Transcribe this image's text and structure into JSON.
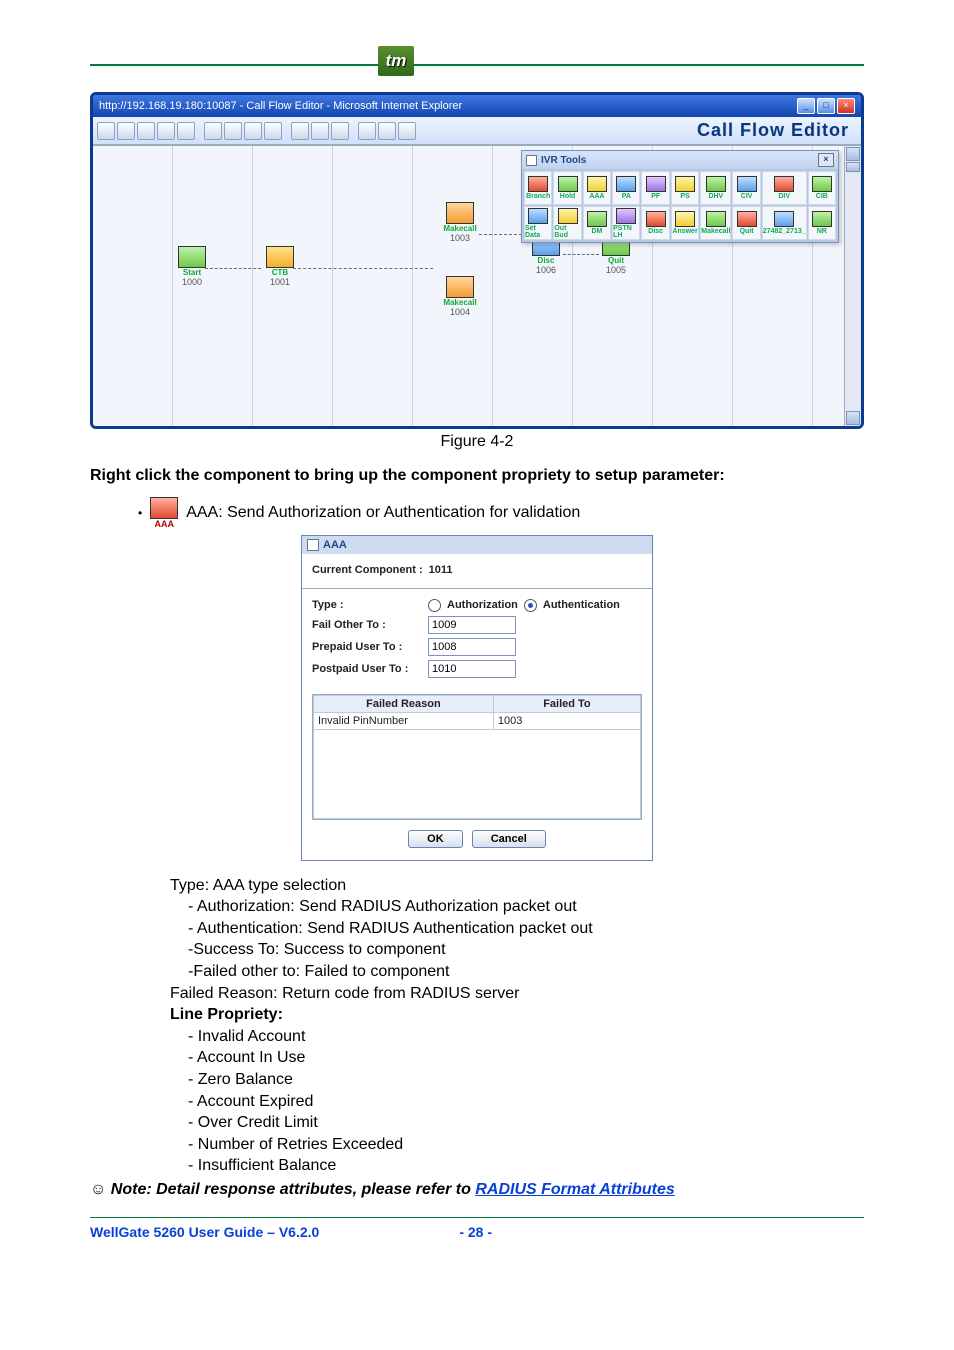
{
  "logo_text": "tm",
  "ie": {
    "title": "http://192.168.19.180:10087 - Call Flow Editor - Microsoft Internet Explorer",
    "app_title": "Call Flow Editor"
  },
  "palette": {
    "title": "IVR Tools",
    "items": [
      {
        "label": "Branch"
      },
      {
        "label": "Hold"
      },
      {
        "label": "AAA"
      },
      {
        "label": "PA"
      },
      {
        "label": "PF"
      },
      {
        "label": "PS"
      },
      {
        "label": "DHV"
      },
      {
        "label": "CIV"
      },
      {
        "label": "DIV"
      },
      {
        "label": "CIB"
      },
      {
        "label": "Set Data"
      },
      {
        "label": "Out Bud"
      },
      {
        "label": "DM"
      },
      {
        "label": "PSTN LH"
      },
      {
        "label": "Disc"
      },
      {
        "label": "Answer"
      },
      {
        "label": "Makecall"
      },
      {
        "label": "Quit"
      },
      {
        "label": "27482_2713_"
      },
      {
        "label": "NR"
      }
    ]
  },
  "nodes": {
    "start": {
      "label": "Start",
      "id": "1000"
    },
    "ctb": {
      "label": "CTB",
      "id": "1001"
    },
    "make1": {
      "label": "Makecall",
      "id": "1003"
    },
    "make2": {
      "label": "Makecall",
      "id": "1004"
    },
    "disc": {
      "label": "Disc",
      "id": "1006"
    },
    "quit": {
      "label": "Quit",
      "id": "1005"
    }
  },
  "figure_caption": "Figure 4-2",
  "para1": "Right click the component to bring up the component propriety to setup parameter:",
  "aaa_icon_label": "AAA",
  "aaa_bullet": "AAA: Send Authorization or Authentication for validation",
  "dlg": {
    "title": "AAA",
    "current_label": "Current Component :",
    "current_value": "1011",
    "type_label": "Type :",
    "radio_auth": "Authorization",
    "radio_authn": "Authentication",
    "fail_other_label": "Fail Other To :",
    "fail_other_value": "1009",
    "prepaid_label": "Prepaid User To :",
    "prepaid_value": "1008",
    "postpaid_label": "Postpaid User To :",
    "postpaid_value": "1010",
    "th_reason": "Failed Reason",
    "th_failed_to": "Failed To",
    "row_reason": "Invalid PinNumber",
    "row_failed_to": "1003",
    "ok": "OK",
    "cancel": "Cancel"
  },
  "explain": {
    "type": "Type: AAA type selection",
    "auth": "- Authorization: Send RADIUS Authorization packet out",
    "authn": "- Authentication: Send RADIUS Authentication packet out",
    "success": "-Success To: Success to component",
    "failed": "-Failed other to: Failed to component",
    "reason": "Failed Reason: Return code from RADIUS server",
    "line_prop": "Line Propriety:",
    "items": [
      "- Invalid Account",
      "- Account In Use",
      "- Zero Balance",
      "- Account Expired",
      "- Over Credit Limit",
      "- Number of Retries Exceeded",
      "- Insufficient Balance"
    ],
    "note_prefix": "☺ Note: Detail response attributes, please refer to ",
    "note_link": "RADIUS Format Attributes"
  },
  "footer": {
    "left": "WellGate 5260 User Guide – V6.2.0",
    "right": "- 28 -"
  }
}
